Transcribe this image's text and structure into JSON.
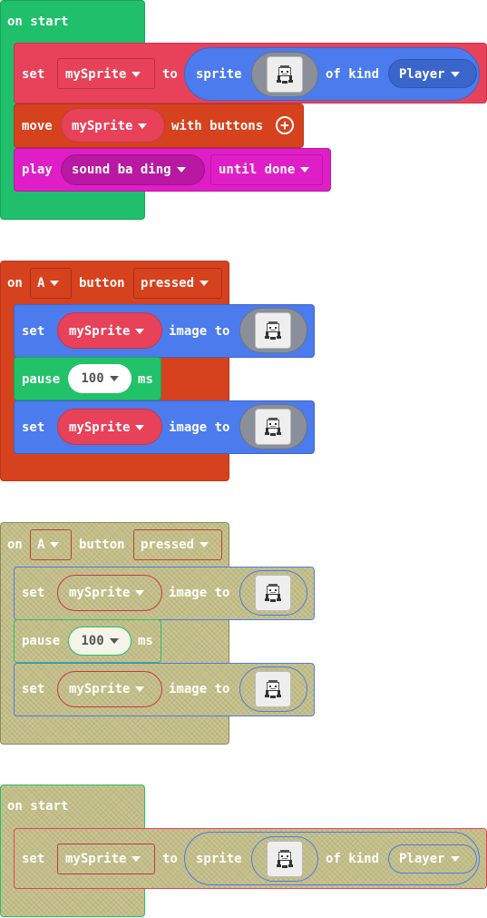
{
  "colors": {
    "events_green": "#1fbf6b",
    "sprites_red": "#e8415a",
    "sprites_blue": "#4b7bec",
    "controller_orange": "#d6411e",
    "music_magenta": "#e01ec8",
    "loops_green": "#21c26a",
    "hatch_fill": "#c9c48a"
  },
  "block1": {
    "hat_label": "on start",
    "set_kw": "set",
    "var_name": "mySprite",
    "to_kw": "to",
    "sprite_kw": "sprite",
    "of_kind_kw": "of kind",
    "kind_value": "Player",
    "move_kw": "move",
    "move_var": "mySprite",
    "with_buttons": "with buttons",
    "plus_icon": "plus-icon",
    "play_kw": "play",
    "sound_name": "sound ba ding",
    "until_done": "until done"
  },
  "block2": {
    "on_kw": "on",
    "button_value": "A",
    "button_kw": "button",
    "event_value": "pressed",
    "set1_kw": "set",
    "set1_var": "mySprite",
    "image_to1": "image to",
    "pause_kw": "pause",
    "pause_value": "100",
    "ms_kw": "ms",
    "set2_kw": "set",
    "set2_var": "mySprite",
    "image_to2": "image to"
  },
  "block3": {
    "on_kw": "on",
    "button_value": "A",
    "button_kw": "button",
    "event_value": "pressed",
    "set1_kw": "set",
    "set1_var": "mySprite",
    "image_to1": "image to",
    "pause_kw": "pause",
    "pause_value": "100",
    "ms_kw": "ms",
    "set2_kw": "set",
    "set2_var": "mySprite",
    "image_to2": "image to"
  },
  "block4": {
    "hat_label": "on start",
    "set_kw": "set",
    "var_name": "mySprite",
    "to_kw": "to",
    "sprite_kw": "sprite",
    "of_kind_kw": "of kind",
    "kind_value": "Player"
  }
}
